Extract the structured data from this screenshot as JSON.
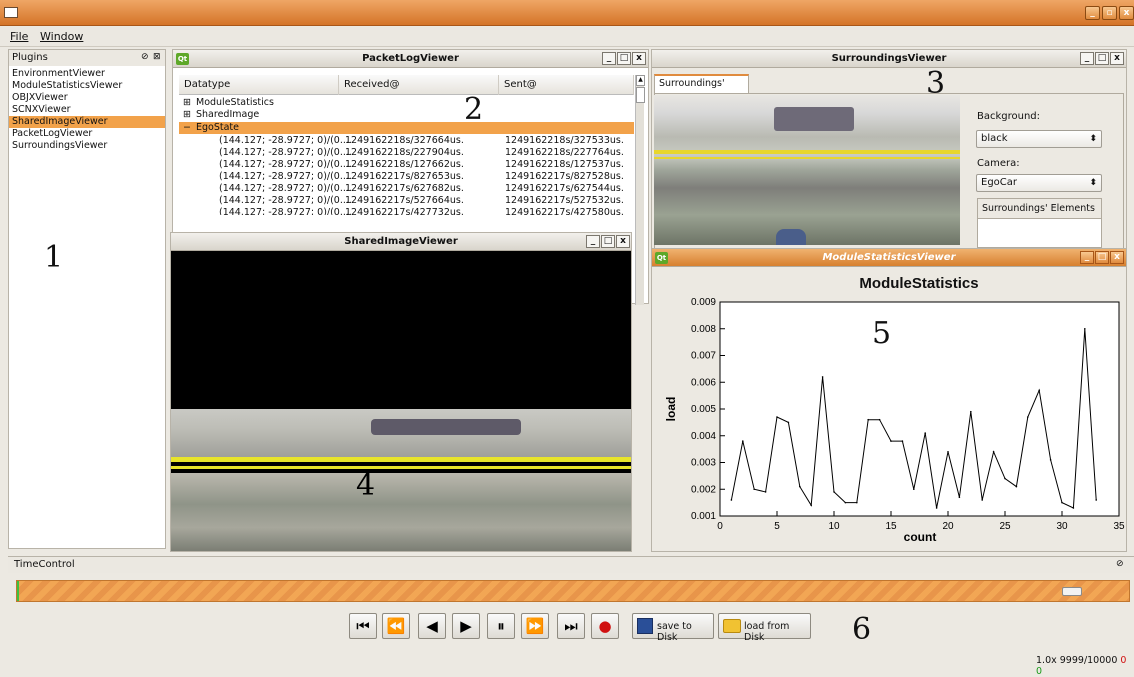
{
  "app": {
    "menu": [
      "File",
      "Window"
    ]
  },
  "plugins": {
    "title": "Plugins",
    "items": [
      "EnvironmentViewer",
      "ModuleStatisticsViewer",
      "OBJXViewer",
      "SCNXViewer",
      "SharedImageViewer",
      "PacketLogViewer",
      "SurroundingsViewer"
    ],
    "selected_index": 4
  },
  "packetlog": {
    "title": "PacketLogViewer",
    "columns": [
      "Datatype",
      "Received@",
      "Sent@"
    ],
    "groups": [
      "ModuleStatistics",
      "SharedImage",
      "EgoState"
    ],
    "rows": [
      {
        "type": "(144.127; -28.9727; 0)/(0....",
        "received": "1249162218s/327664us.",
        "sent": "1249162218s/327533us."
      },
      {
        "type": "(144.127; -28.9727; 0)/(0....",
        "received": "1249162218s/227904us.",
        "sent": "1249162218s/227764us."
      },
      {
        "type": "(144.127; -28.9727; 0)/(0....",
        "received": "1249162218s/127662us.",
        "sent": "1249162218s/127537us."
      },
      {
        "type": "(144.127; -28.9727; 0)/(0....",
        "received": "1249162217s/827653us.",
        "sent": "1249162217s/827528us."
      },
      {
        "type": "(144.127; -28.9727; 0)/(0....",
        "received": "1249162217s/627682us.",
        "sent": "1249162217s/627544us."
      },
      {
        "type": "(144.127; -28.9727; 0)/(0....",
        "received": "1249162217s/527664us.",
        "sent": "1249162217s/527532us."
      },
      {
        "type": "(144.127; -28.9727; 0)/(0....",
        "received": "1249162217s/427732us.",
        "sent": "1249162217s/427580us."
      }
    ]
  },
  "surroundings": {
    "title": "SurroundingsViewer",
    "tab": "Surroundings' View",
    "background_label": "Background:",
    "background_value": "black",
    "camera_label": "Camera:",
    "camera_value": "EgoCar",
    "elements_label": "Surroundings' Elements"
  },
  "sharedimage": {
    "title": "SharedImageViewer"
  },
  "modulestats": {
    "title": "ModuleStatisticsViewer"
  },
  "timecontrol": {
    "title": "TimeControl",
    "save_label": "save to Disk",
    "load_label": "load from Disk",
    "speed": "1.0x",
    "counter": "9999/10000",
    "red_count": "0",
    "green_count": "0",
    "progress": 0.98
  },
  "callouts": [
    "1",
    "2",
    "3",
    "4",
    "5",
    "6"
  ],
  "chart_data": {
    "type": "line",
    "title": "ModuleStatistics",
    "xlabel": "count",
    "ylabel": "load",
    "xlim": [
      0,
      35
    ],
    "ylim": [
      0.001,
      0.009
    ],
    "xticks": [
      "0",
      "5",
      "10",
      "15",
      "20",
      "25",
      "30",
      "35"
    ],
    "yticks": [
      "0.001",
      "0.002",
      "0.003",
      "0.004",
      "0.005",
      "0.006",
      "0.007",
      "0.008",
      "0.009"
    ],
    "x": [
      1,
      2,
      3,
      4,
      5,
      6,
      7,
      8,
      9,
      10,
      11,
      12,
      13,
      14,
      15,
      16,
      17,
      18,
      19,
      20,
      21,
      22,
      23,
      24,
      25,
      26,
      27,
      28,
      29,
      30,
      31,
      32,
      33
    ],
    "series": [
      {
        "values": [
          0.0016,
          0.0038,
          0.002,
          0.0019,
          0.0047,
          0.0045,
          0.0021,
          0.0014,
          0.0062,
          0.0019,
          0.0015,
          0.0015,
          0.0046,
          0.0046,
          0.0038,
          0.0038,
          0.002,
          0.0041,
          0.0013,
          0.0034,
          0.0017,
          0.0049,
          0.0016,
          0.0034,
          0.0024,
          0.0021,
          0.0047,
          0.0057,
          0.0031,
          0.0015,
          0.0013,
          0.008,
          0.0016
        ]
      }
    ]
  }
}
